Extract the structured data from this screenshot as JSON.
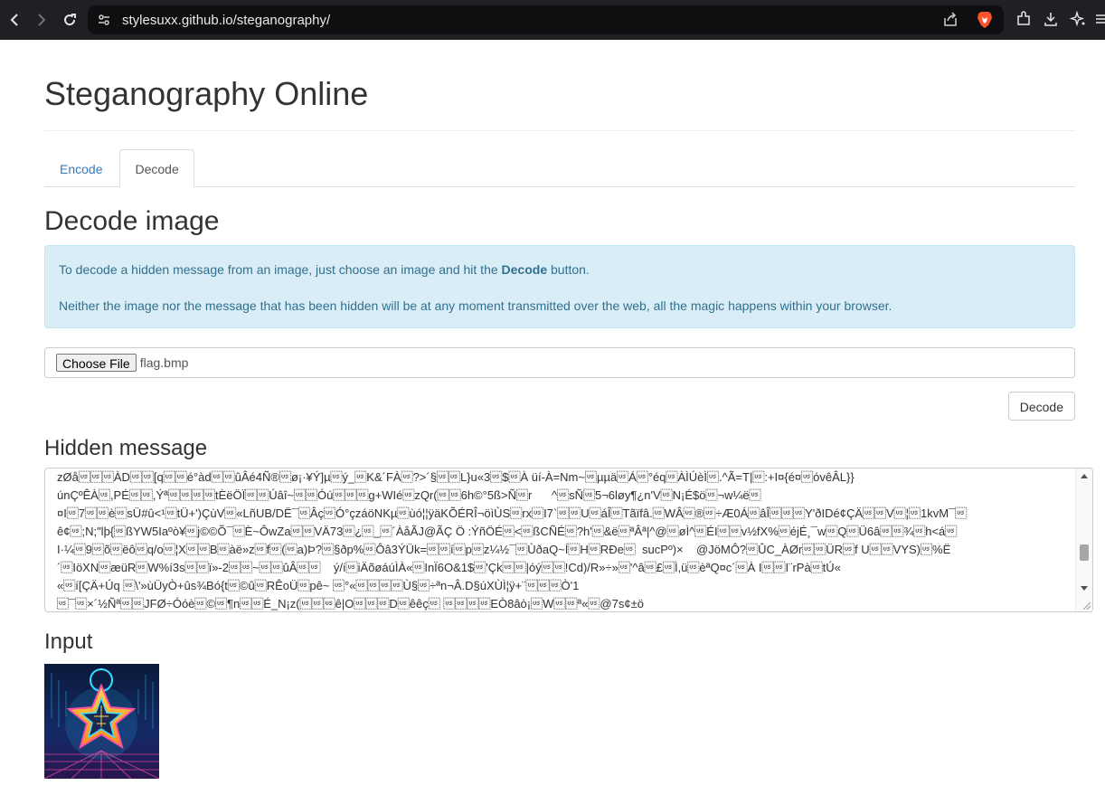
{
  "browser": {
    "url": "stylesuxx.github.io/steganography/",
    "icons": [
      "back-arrow-icon",
      "forward-arrow-icon",
      "reload-icon",
      "site-info-icon",
      "share-icon",
      "brave-shield-icon",
      "extensions-icon",
      "download-icon",
      "sparkle-icon",
      "menu-icon"
    ]
  },
  "page": {
    "title": "Steganography Online",
    "tabs": [
      {
        "label": "Encode",
        "active": false
      },
      {
        "label": "Decode",
        "active": true
      }
    ]
  },
  "decode": {
    "heading": "Decode image",
    "info_line1_pre": "To decode a hidden message from an image, just choose an image and hit the ",
    "info_line1_bold": "Decode",
    "info_line1_post": " button.",
    "info_line2": "Neither the image nor the message that has been hidden will be at any moment transmitted over the web, all the magic happens within your browser.",
    "file_button": "Choose File",
    "file_name": "flag.bmp",
    "decode_button": "Decode"
  },
  "hidden_message": {
    "heading": "Hidden message",
    "text": "zØå\u001f\u001f\u001fÀD\u001f\u001f[q\u001f\u001fé°àd\u001f\u001fûÂé4Ñ®\u001fø¡·¥Ý]µ\u001fý_\u001fK&´FÀ\u001f?>´§\u001f\u001fL}u«3\u001f$\u001fÀ üí-À=Nm~\u001fµµä\u001fÁ\u001f°éq\u001fÀÌÚèÌ\u001f.^Ã=T|\u001f:+I¤{é¤\u001fóvêÂL}}\núnÇºÊÀ\u001f,PÉ\u001f\u001f,Ýª\u001f\u001f\u001f\u001ftÈëÖÏ\u001f\u001fÚâî~\u001f\u001fÓú\u001f\u001f\u001fg+WIé\u001fzQr(\u001f\u001f6h©°5ß>Ñ\u001fr      ^\u001fsÑ\u001f5¬6løy¶¿n'V\u001fN¡É$ö\u001f¬w¼ë\u001f\n¤I\u001f7\u001f\u001fè\u001fsÜ#û<¹\u001ftÜ+')ÇùV\u001f«LñUB/DË¯\u001fÂç\u001fÓ°çzáöNKµ\u001fùó¦¦ÿäKÕÉRÎ¬öìÙS\u001frx\u001fI7`\u001f\u001fU\u001fáÎ\u001fTãïfâ.\u001fWÂ\u001f®\u001f÷Æ0Á\u001fâÎ\u001f\u001f\u001fY'ðIDé¢ÇÄ\u001f\u001fV\u001f¦\u001f1kvM¯\u001f\nê¢\u001f;N;\"lþ{\u001fßYW5Iaºò¥\u001fj©©Õ¯\u001fÈ~ÔwZa\u001f\u001fVÄ73\u001f¿\u001f_\u001f´ÀåÃJ@ÃÇ Ö :ÝñÖÉ\u001f<\u001fßCÑÉ\u001f?h'\u001f&ë\u001fªÂª|^@\u001føÌ^\u001fÉI\u001f\u001fv½fX%\u001féjÉ¸¯w\u001fQ\u001fÜ6â\u001f\u001f¾\u001fh<á\u001f\nI·¼\u001f9\u001fõ\u001fëô\u001fq/o\u001f¦X\u001f\u001fB\u001fàë»z\u001ff\u001f(\u001fa)Þ?\u001f§ðp%\u001fÔâ3ÝÜk=\u001f\u001fí\u001fp\u001fz¼½¯\u001fÙðaQ~Í\u001fH\u001fRÐe\u001f  sucPº)×    @JöMÔ?\u001fÛC_ÀØr\u001f\u001fÜR\u001ff U\u001f\u001fVYS)\u001f%Ë\n´\u001fIöXN\u001fæüR\u001fW%í3s\u001f\u001fï»-2\u001f\u001f~\u001f\u001fûÂ\u001f\u001f    ý/í\u001fiÄõøáúÌÀ«\u001fInÏ6O&1$\u001f'Çk\u001f\u001f|óý\u001f\u001f!Cd)/R»÷»\u001f'^â\u001f£\u001fÌ,ü\u001fèªQ¤c´\u001fÀ I\u001f\u001fI¨rPà\u001ftÚ«\n«\u001fí[ÇÄ+Úq \u001f\\'»ùÜyÒ+ûs¾Bó{t\u001f©û\u001fRÊoÜ\u001fpê~ \u001f°«\u001f\u001f\u001f\u001fÙ§\u001f÷ªn¬Â.D§úXÙÌ¦ÿ+¨\u001f\u001f\u001fÒ'1\n\u001f¯\u001f×´½Ñª\u001f\u001fJFØ÷Óóè\u001f©\u001f¶n\u001f\u001fÉ_N¡z(\u001f\u001f\u001fê|O\u001f\u001f\u001fD\u001fêêç\u001f \u001f\u001f\u001f\u001fEÒ8âò¡\u001fW\u001f\u001fª«\u001f@7s¢±ö"
  },
  "input": {
    "heading": "Input",
    "image_icon": "star-circuit-image"
  }
}
